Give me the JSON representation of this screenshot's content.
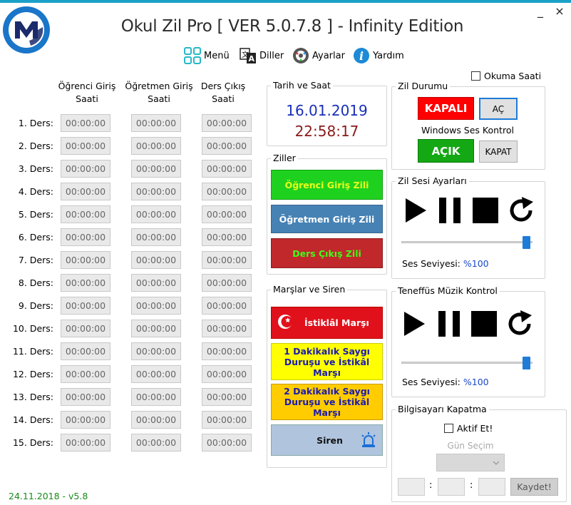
{
  "window": {
    "title": "Okul Zil Pro [ VER 5.0.7.8 ] - Infinity Edition",
    "minimize": "_",
    "close": "×"
  },
  "menu": {
    "items": [
      {
        "label": "Menü",
        "icon": "grid-icon"
      },
      {
        "label": "Diller",
        "icon": "translate-icon"
      },
      {
        "label": "Ayarlar",
        "icon": "gear-icon"
      },
      {
        "label": "Yardım",
        "icon": "info-icon"
      }
    ]
  },
  "schedule": {
    "headers": [
      "Öğrenci Giriş\nSaati",
      "Öğretmen Giriş\nSaati",
      "Ders Çıkış\nSaati"
    ],
    "rows": [
      {
        "label": "1. Ders:",
        "times": [
          "00:00:00",
          "00:00:00",
          "00:00:00"
        ]
      },
      {
        "label": "2. Ders:",
        "times": [
          "00:00:00",
          "00:00:00",
          "00:00:00"
        ]
      },
      {
        "label": "3. Ders:",
        "times": [
          "00:00:00",
          "00:00:00",
          "00:00:00"
        ]
      },
      {
        "label": "4. Ders:",
        "times": [
          "00:00:00",
          "00:00:00",
          "00:00:00"
        ]
      },
      {
        "label": "5. Ders:",
        "times": [
          "00:00:00",
          "00:00:00",
          "00:00:00"
        ]
      },
      {
        "label": "6. Ders:",
        "times": [
          "00:00:00",
          "00:00:00",
          "00:00:00"
        ]
      },
      {
        "label": "7. Ders:",
        "times": [
          "00:00:00",
          "00:00:00",
          "00:00:00"
        ]
      },
      {
        "label": "8. Ders:",
        "times": [
          "00:00:00",
          "00:00:00",
          "00:00:00"
        ]
      },
      {
        "label": "9. Ders:",
        "times": [
          "00:00:00",
          "00:00:00",
          "00:00:00"
        ]
      },
      {
        "label": "10. Ders:",
        "times": [
          "00:00:00",
          "00:00:00",
          "00:00:00"
        ]
      },
      {
        "label": "11. Ders:",
        "times": [
          "00:00:00",
          "00:00:00",
          "00:00:00"
        ]
      },
      {
        "label": "12. Ders:",
        "times": [
          "00:00:00",
          "00:00:00",
          "00:00:00"
        ]
      },
      {
        "label": "13. Ders:",
        "times": [
          "00:00:00",
          "00:00:00",
          "00:00:00"
        ]
      },
      {
        "label": "14. Ders:",
        "times": [
          "00:00:00",
          "00:00:00",
          "00:00:00"
        ]
      },
      {
        "label": "15. Ders:",
        "times": [
          "00:00:00",
          "00:00:00",
          "00:00:00"
        ]
      }
    ]
  },
  "datetime": {
    "title": "Tarih ve Saat",
    "date": "16.01.2019",
    "time": "22:58:17",
    "date_color": "#1a2fb8",
    "time_color": "#8b1a1a"
  },
  "bells": {
    "title": "Ziller",
    "student": {
      "label": "Öğrenci Giriş Zili",
      "bg": "#1fd11f",
      "fg": "#e8ff1a"
    },
    "teacher": {
      "label": "Öğretmen Giriş Zili",
      "bg": "#4682b4",
      "fg": "#ffffff"
    },
    "exit": {
      "label": "Ders Çıkış Zili",
      "bg": "#c0282b",
      "fg": "#3dff1a"
    }
  },
  "marches": {
    "title": "Marşlar ve Siren",
    "anthem": "İstiklâl Marşı",
    "one_min_line1": "1 Dakikalık Saygı",
    "one_min_line2": "Duruşu ve İstikâl Marşı",
    "two_min_line1": "2 Dakikalık Saygı",
    "two_min_line2": "Duruşu ve İstikâl Marşı",
    "siren": "Siren"
  },
  "reading": {
    "label": "Okuma Saati",
    "checked": false
  },
  "bell_status": {
    "title": "Zil Durumu",
    "state": "KAPALI",
    "open_btn": "AÇ",
    "sound_label": "Windows Ses Kontrol",
    "sound_state": "AÇIK",
    "close_btn": "KAPAT"
  },
  "bell_sound": {
    "title": "Zil Sesi Ayarları",
    "volume_label": "Ses Seviyesi:",
    "volume_value": "%100",
    "volume": 1.0
  },
  "break_music": {
    "title": "Teneffüs Müzik Kontrol",
    "volume_label": "Ses Seviyesi:",
    "volume_value": "%100",
    "volume": 1.0
  },
  "shutdown": {
    "title": "Bilgisayarı Kapatma",
    "enable_label": "Aktif Et!",
    "day_label": "Gün Seçim",
    "sep1": ":",
    "sep2": ":",
    "save_btn": "Kaydet!"
  },
  "footer": {
    "version": "24.11.2018 - v5.8",
    "color": "#1a8a1a"
  }
}
